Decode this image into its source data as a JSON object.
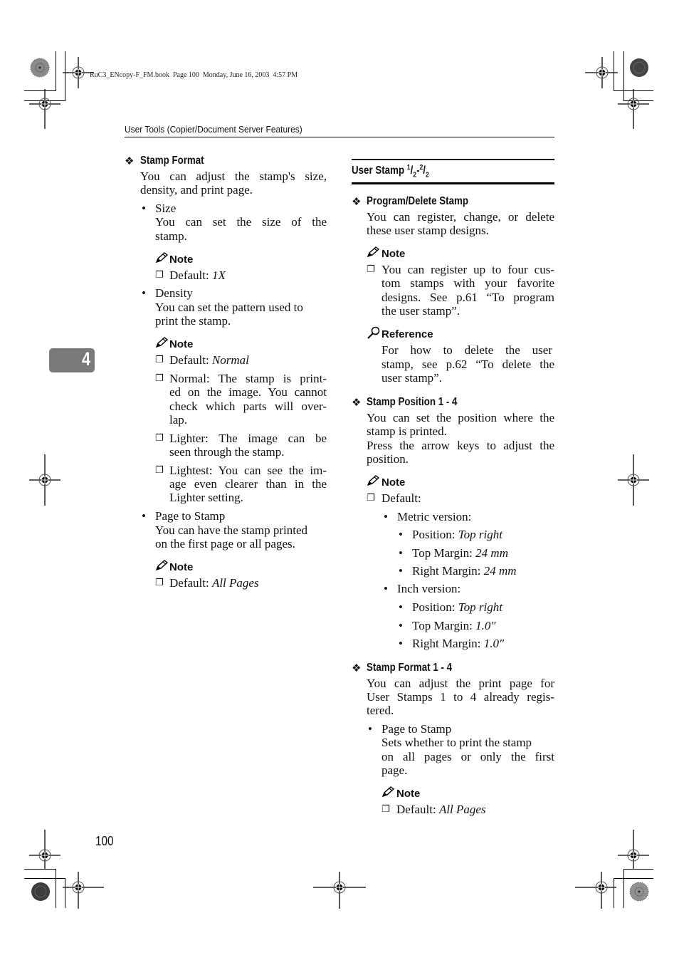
{
  "print_info": "RuC3_ENcopy-F_FM.book  Page 100  Monday, June 16, 2003  4:57 PM",
  "running_header": "User Tools (Copier/Document Server Features)",
  "chapter_tab": "4",
  "page_number": "100",
  "icons": {
    "section_bullet": "❖",
    "note": "pencil-icon",
    "reference": "magnifier-icon",
    "checkbox": "❐",
    "bullet": "•"
  },
  "left": {
    "stamp_format": {
      "heading": "Stamp Format",
      "desc": [
        "You can adjust the stamp's size,",
        "density, and print page."
      ],
      "size": {
        "label": "Size",
        "desc": [
          "You can set the size of the",
          "stamp."
        ],
        "note_label": "Note",
        "default_prefix": "Default: ",
        "default_value": "1X"
      },
      "density": {
        "label": "Density",
        "desc": [
          "You can set the pattern used to",
          "print the stamp."
        ],
        "note_label": "Note",
        "default_prefix": "Default: ",
        "default_value": "Normal",
        "items": [
          [
            "Normal: The stamp is print-",
            "ed on the image. You cannot",
            "check which parts will over-",
            "lap."
          ],
          [
            "Lighter: The image can be",
            "seen through the stamp."
          ],
          [
            "Lightest: You can see the im-",
            "age even clearer than in the",
            "Lighter setting."
          ]
        ]
      },
      "page_to_stamp": {
        "label": "Page to Stamp",
        "desc": [
          "You can have the stamp printed",
          "on the first page or all pages."
        ],
        "note_label": "Note",
        "default_prefix": "Default: ",
        "default_value": "All Pages"
      }
    }
  },
  "right": {
    "title_main": "User Stamp ",
    "title_frac1_num": "1",
    "title_frac1_den": "2",
    "title_sep": "-",
    "title_frac2_num": "2",
    "title_frac2_den": "2",
    "program_delete": {
      "heading": "Program/Delete Stamp",
      "desc": [
        "You can register, change, or delete",
        "these user stamp designs."
      ],
      "note_label": "Note",
      "note_item": [
        "You can register up to four cus-",
        "tom stamps with your favorite",
        "designs. See p.61 “To program",
        "the user stamp”."
      ],
      "reference_label": "Reference",
      "reference_text": [
        "For how to delete the user",
        "stamp, see p.62 “To delete the",
        "user stamp”."
      ]
    },
    "stamp_position": {
      "heading": "Stamp Position 1 - 4",
      "desc": [
        "You can set the position where the",
        "stamp is printed.",
        "Press the arrow keys to adjust the",
        "position."
      ],
      "note_label": "Note",
      "default_label": "Default:",
      "metric": {
        "label": "Metric version:",
        "items": [
          {
            "k": "Position: ",
            "v": "Top right"
          },
          {
            "k": "Top Margin: ",
            "v": "24 mm"
          },
          {
            "k": "Right Margin: ",
            "v": "24 mm"
          }
        ]
      },
      "inch": {
        "label": "Inch version:",
        "items": [
          {
            "k": "Position: ",
            "v": "Top right"
          },
          {
            "k": "Top Margin: ",
            "v": "1.0″"
          },
          {
            "k": "Right Margin: ",
            "v": "1.0″"
          }
        ]
      }
    },
    "stamp_format_14": {
      "heading": "Stamp Format 1 - 4",
      "desc": [
        "You can adjust the print page for",
        "User Stamps 1 to 4 already regis-",
        "tered."
      ],
      "page_to_stamp": {
        "label": "Page to Stamp",
        "desc": [
          "Sets whether to print the stamp",
          "on all pages or only the first",
          "page."
        ],
        "note_label": "Note",
        "default_prefix": "Default: ",
        "default_value": "All Pages"
      }
    }
  }
}
